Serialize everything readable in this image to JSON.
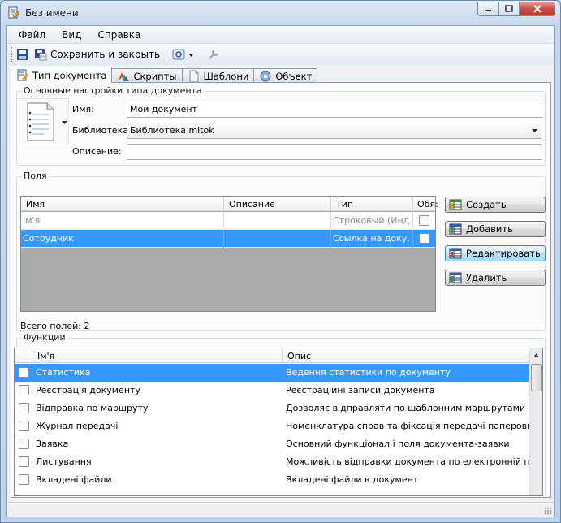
{
  "window": {
    "title": "Без имени"
  },
  "menu": {
    "items": [
      "Файл",
      "Вид",
      "Справка"
    ]
  },
  "toolbar": {
    "save_close_label": "Сохранить и закрыть"
  },
  "tabs": [
    {
      "label": "Тип документа",
      "icon": "document-type-icon",
      "active": true
    },
    {
      "label": "Скрипты",
      "icon": "scripts-icon",
      "active": false
    },
    {
      "label": "Шаблони",
      "icon": "templates-icon",
      "active": false
    },
    {
      "label": "Объект",
      "icon": "object-gear-icon",
      "active": false
    }
  ],
  "basic_settings": {
    "title": "Основные настройки типа документа",
    "name_label": "Имя:",
    "name_value": "Мой документ",
    "library_label": "Библиотека:",
    "library_value": "Библиотека mitok",
    "description_label": "Описание:",
    "description_value": ""
  },
  "fields": {
    "title": "Поля",
    "columns": [
      "Имя",
      "Описание",
      "Тип",
      "Обя:"
    ],
    "rows": [
      {
        "name": "Ім'я",
        "description": "",
        "type": "Строковый (Инд...",
        "required": false,
        "selected": false,
        "dimmed": true
      },
      {
        "name": "Сотрудник",
        "description": "",
        "type": "Ссылка на доку...",
        "required": false,
        "selected": true,
        "dimmed": false
      }
    ],
    "total_label": "Всего полей: 2",
    "buttons": {
      "create": "Создать",
      "add": "Добавить",
      "edit": "Редактировать",
      "delete": "Удалить"
    }
  },
  "functions": {
    "title": "Функции",
    "columns": [
      "Ім'я",
      "Опис"
    ],
    "rows": [
      {
        "name": "Статистика",
        "description": "Ведення статистики по документу",
        "checked": false,
        "selected": true
      },
      {
        "name": "Реєстрація документу",
        "description": "Реєстраційні записи документа",
        "checked": false,
        "selected": false
      },
      {
        "name": "Відправка по маршруту",
        "description": "Дозволяє відправляти по шаблонним маршрутами",
        "checked": false,
        "selected": false
      },
      {
        "name": "Журнал передачі",
        "description": "Номенклатура справ та фіксація передачі паперових копі...",
        "checked": false,
        "selected": false
      },
      {
        "name": "Заявка",
        "description": "Основний функціонал і поля документа-заявки",
        "checked": false,
        "selected": false
      },
      {
        "name": "Листування",
        "description": "Можливість відправки документа по електронній пошті",
        "checked": false,
        "selected": false
      },
      {
        "name": "Вкладені файли",
        "description": "Вкладені файли в документ",
        "checked": false,
        "selected": false
      }
    ]
  },
  "colors": {
    "selection": "#3399ff",
    "grid_empty": "#ababab",
    "close_button": "#c75050"
  }
}
